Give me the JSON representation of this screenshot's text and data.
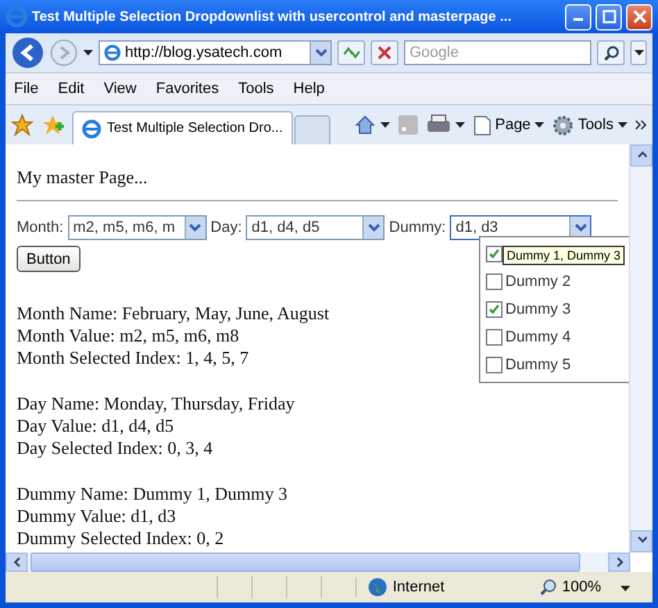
{
  "window": {
    "title": "Test Multiple Selection Dropdownlist with usercontrol and masterpage ..."
  },
  "address_bar": {
    "url": "http://blog.ysatech.com"
  },
  "search": {
    "placeholder": "Google"
  },
  "menu": [
    "File",
    "Edit",
    "View",
    "Favorites",
    "Tools",
    "Help"
  ],
  "tabs": [
    {
      "label": "Test Multiple Selection Dro...",
      "selected": true
    }
  ],
  "command_bar": [
    {
      "kind": "home"
    },
    {
      "kind": "feeds"
    },
    {
      "kind": "print"
    },
    {
      "kind": "page",
      "label": "Page"
    },
    {
      "kind": "tools",
      "label": "Tools"
    }
  ],
  "page": {
    "heading": "My master Page...",
    "fields": [
      {
        "label": "Month:",
        "value": "m2, m5, m6, m"
      },
      {
        "label": "Day:",
        "value": "d1, d4, d5"
      },
      {
        "label": "Dummy:",
        "value": "d1, d3",
        "expanded": true
      }
    ],
    "button": "Button",
    "dropdown": [
      {
        "checked": true
      },
      {
        "label": "Dummy 2",
        "checked": false
      },
      {
        "label": "Dummy 3",
        "checked": true
      },
      {
        "label": "Dummy 4",
        "checked": false
      },
      {
        "label": "Dummy 5",
        "checked": false
      }
    ],
    "tooltip": "Dummy 1, Dummy 3",
    "results": [
      [
        "Month Name: February, May, June, August",
        "Month Value: m2, m5, m6, m8",
        "Month Selected Index: 1, 4, 5, 7"
      ],
      [
        "Day Name: Monday, Thursday, Friday",
        "Day Value: d1, d4, d5",
        "Day Selected Index: 0, 3, 4"
      ],
      [
        "Dummy Name: Dummy 1, Dummy 3",
        "Dummy Value: d1, d3",
        "Dummy Selected Index: 0, 2"
      ]
    ]
  },
  "status_bar": {
    "zone": "Internet",
    "zoom": "100%"
  }
}
